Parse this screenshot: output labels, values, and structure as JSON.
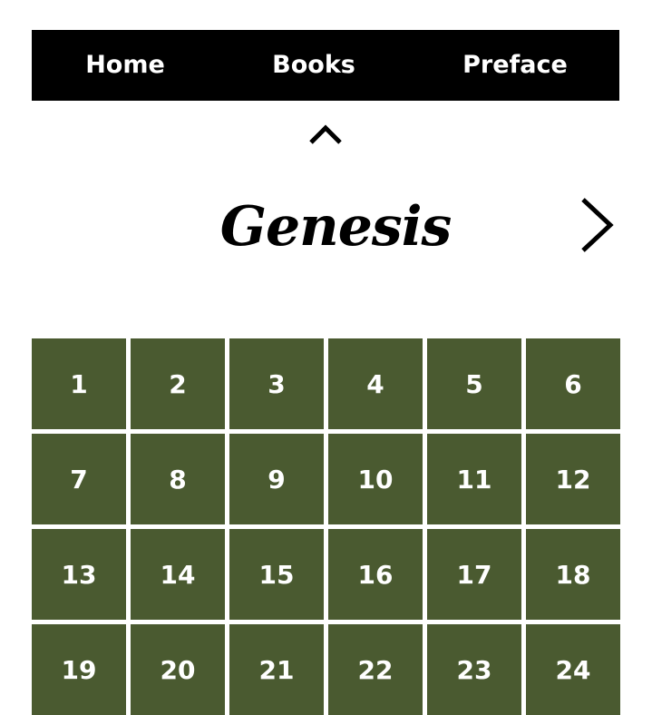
{
  "nav": {
    "items": [
      {
        "label": "Home"
      },
      {
        "label": "Books"
      },
      {
        "label": "Preface"
      }
    ]
  },
  "book": {
    "title": "Genesis"
  },
  "icons": {
    "collapse": "chevron-up-icon",
    "next": "chevron-right-icon"
  },
  "colors": {
    "nav_background": "#000000",
    "cell_background": "#4a5a30",
    "cell_text": "#ffffff"
  },
  "chapters": [
    "1",
    "2",
    "3",
    "4",
    "5",
    "6",
    "7",
    "8",
    "9",
    "10",
    "11",
    "12",
    "13",
    "14",
    "15",
    "16",
    "17",
    "18",
    "19",
    "20",
    "21",
    "22",
    "23",
    "24"
  ]
}
